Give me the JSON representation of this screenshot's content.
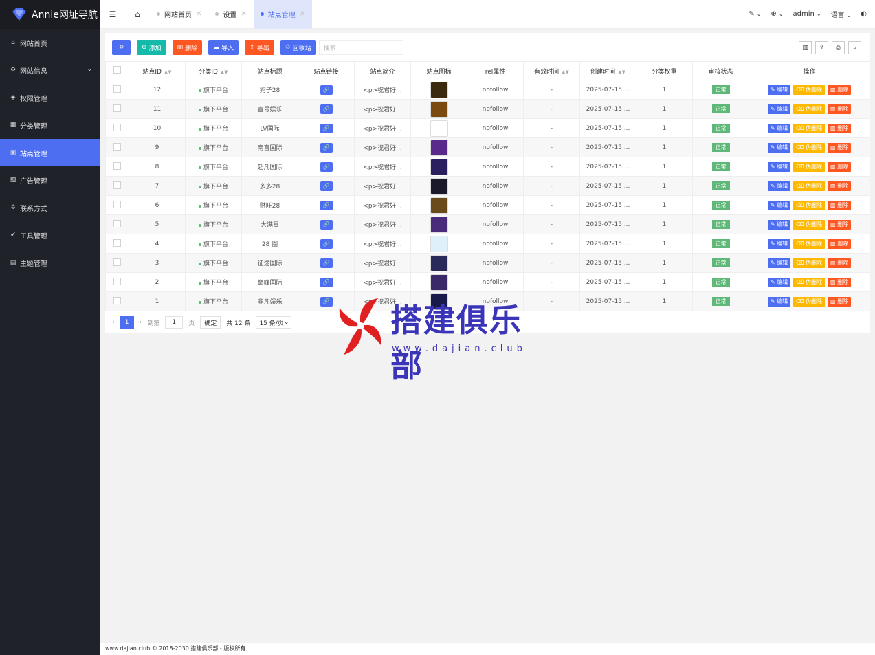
{
  "sidebar": {
    "logo": "Annie网址导航",
    "items": [
      {
        "label": "网站首页",
        "icon": "home-icon",
        "glyph": "⌂"
      },
      {
        "label": "网站信息",
        "icon": "gear-icon",
        "glyph": "⚙"
      },
      {
        "label": "权限管理",
        "icon": "shield-icon",
        "glyph": "◈"
      },
      {
        "label": "分类管理",
        "icon": "grid-icon",
        "glyph": "▦"
      },
      {
        "label": "站点管理",
        "icon": "windows-icon",
        "glyph": "▣"
      },
      {
        "label": "广告管理",
        "icon": "image-icon",
        "glyph": "▨"
      },
      {
        "label": "联系方式",
        "icon": "settings-icon",
        "glyph": "✲"
      },
      {
        "label": "工具管理",
        "icon": "check-shield-icon",
        "glyph": "✔"
      },
      {
        "label": "主题管理",
        "icon": "calendar-icon",
        "glyph": "▤"
      }
    ]
  },
  "header": {
    "tabs": [
      "网站首页",
      "设置",
      "站点管理"
    ],
    "user": "admin",
    "language": "语言"
  },
  "toolbar": {
    "refresh": "",
    "add": "添加",
    "delete": "删除",
    "import": "导入",
    "export": "导出",
    "recycle": "回收站",
    "search_placeholder": "搜索"
  },
  "table": {
    "columns": [
      "站点ID",
      "分类ID",
      "站点标题",
      "站点链接",
      "站点简介",
      "站点图标",
      "rel属性",
      "有效时间",
      "创建时间",
      "分类权重",
      "审核状态",
      "操作"
    ],
    "rows": [
      {
        "id": "12",
        "cat": "旗下平台",
        "title": "狗子28",
        "intro": "<p>祝君好...",
        "rel": "nofollow",
        "valid": "-",
        "created": "2025-07-15 ...",
        "weight": "1",
        "status": "正常",
        "color": "#3b2a10"
      },
      {
        "id": "11",
        "cat": "旗下平台",
        "title": "壹号娱乐",
        "intro": "<p>祝君好...",
        "rel": "nofollow",
        "valid": "-",
        "created": "2025-07-15 ...",
        "weight": "1",
        "status": "正常",
        "color": "#7a4a10"
      },
      {
        "id": "10",
        "cat": "旗下平台",
        "title": "LV国际",
        "intro": "<p>祝君好...",
        "rel": "nofollow",
        "valid": "-",
        "created": "2025-07-15 ...",
        "weight": "1",
        "status": "正常",
        "color": "#ffffff"
      },
      {
        "id": "9",
        "cat": "旗下平台",
        "title": "南宫国际",
        "intro": "<p>祝君好...",
        "rel": "nofollow",
        "valid": "-",
        "created": "2025-07-15 ...",
        "weight": "1",
        "status": "正常",
        "color": "#5a2a8a"
      },
      {
        "id": "8",
        "cat": "旗下平台",
        "title": "超凡国际",
        "intro": "<p>祝君好...",
        "rel": "nofollow",
        "valid": "-",
        "created": "2025-07-15 ...",
        "weight": "1",
        "status": "正常",
        "color": "#2a2060"
      },
      {
        "id": "7",
        "cat": "旗下平台",
        "title": "多多28",
        "intro": "<p>祝君好...",
        "rel": "nofollow",
        "valid": "-",
        "created": "2025-07-15 ...",
        "weight": "1",
        "status": "正常",
        "color": "#1a1a2a"
      },
      {
        "id": "6",
        "cat": "旗下平台",
        "title": "财旺28",
        "intro": "<p>祝君好...",
        "rel": "nofollow",
        "valid": "-",
        "created": "2025-07-15 ...",
        "weight": "1",
        "status": "正常",
        "color": "#6a4a1a"
      },
      {
        "id": "5",
        "cat": "旗下平台",
        "title": "大满贯",
        "intro": "<p>祝君好...",
        "rel": "nofollow",
        "valid": "-",
        "created": "2025-07-15 ...",
        "weight": "1",
        "status": "正常",
        "color": "#4a2a7a"
      },
      {
        "id": "4",
        "cat": "旗下平台",
        "title": "28 圈",
        "intro": "<p>祝君好...",
        "rel": "nofollow",
        "valid": "-",
        "created": "2025-07-15 ...",
        "weight": "1",
        "status": "正常",
        "color": "#dff0fb"
      },
      {
        "id": "3",
        "cat": "旗下平台",
        "title": "征途国际",
        "intro": "<p>祝君好...",
        "rel": "nofollow",
        "valid": "-",
        "created": "2025-07-15 ...",
        "weight": "1",
        "status": "正常",
        "color": "#2a2a5a"
      },
      {
        "id": "2",
        "cat": "旗下平台",
        "title": "巅峰国际",
        "intro": "<p>祝君好...",
        "rel": "nofollow",
        "valid": "-",
        "created": "2025-07-15 ...",
        "weight": "1",
        "status": "正常",
        "color": "#3a2a6a"
      },
      {
        "id": "1",
        "cat": "旗下平台",
        "title": "非凡娱乐",
        "intro": "<p>祝君好...",
        "rel": "nofollow",
        "valid": "-",
        "created": "2025-07-15 ...",
        "weight": "1",
        "status": "正常",
        "color": "#1a1a4a"
      }
    ],
    "ops": {
      "edit": "编辑",
      "fake_delete": "伪删除",
      "delete": "删除"
    }
  },
  "pager": {
    "current": "1",
    "goto_label": "到第",
    "goto_value": "1",
    "page_label": "页",
    "confirm": "确定",
    "total": "共 12 条",
    "page_size": "15 条/页"
  },
  "footer": "www.dajian.club © 2018-2030 搭建俱乐部 - 版权所有",
  "watermark": {
    "title": "搭建俱乐部",
    "url": "www.dajian.club"
  },
  "colors": {
    "accent": "#4e6ef2",
    "sidebar": "#20222a",
    "green": "#5fb878",
    "orange": "#ffb800",
    "red": "#ff5722",
    "teal": "#16baaa"
  }
}
